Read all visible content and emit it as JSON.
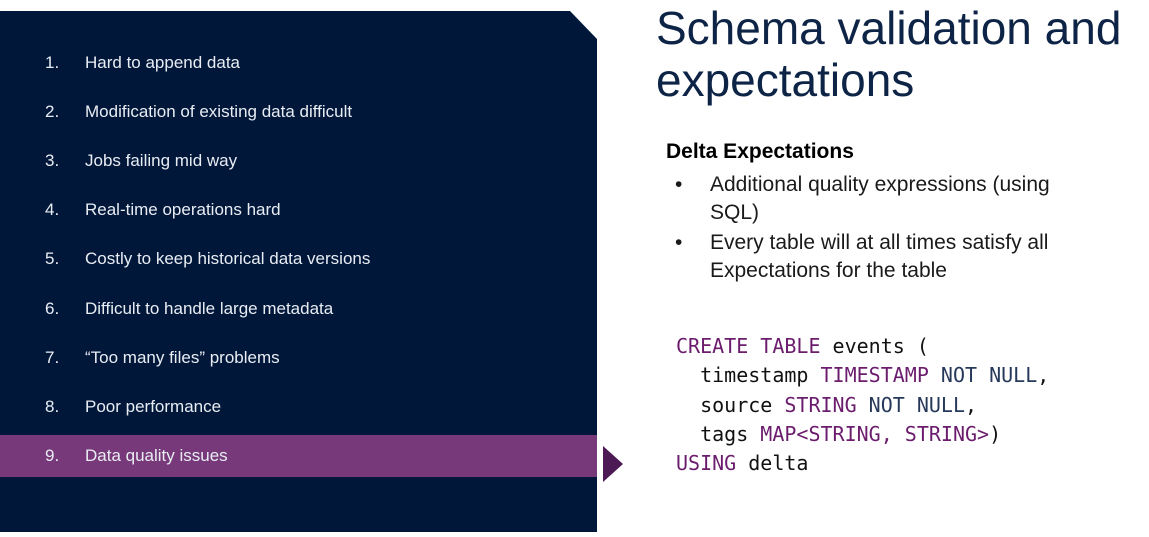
{
  "sidebar": {
    "items": [
      {
        "num": "1.",
        "label": "Hard to append data"
      },
      {
        "num": "2.",
        "label": "Modification of existing data difficult"
      },
      {
        "num": "3.",
        "label": "Jobs failing mid way"
      },
      {
        "num": "4.",
        "label": "Real-time operations hard"
      },
      {
        "num": "5.",
        "label": "Costly to keep historical data versions"
      },
      {
        "num": "6.",
        "label": "Difficult to handle large metadata"
      },
      {
        "num": "7.",
        "label": "“Too many files” problems"
      },
      {
        "num": "8.",
        "label": "Poor performance"
      },
      {
        "num": "9.",
        "label": "Data quality issues"
      }
    ],
    "active_index": 8
  },
  "main": {
    "title_line1": "Schema validation and",
    "title_line2": "expectations",
    "subheading": "Delta Expectations",
    "bullets": [
      "Additional quality expressions (using SQL)",
      "Every table will at all times satisfy all Expectations for the table"
    ],
    "bullet_glyph": "•",
    "code": {
      "line1": {
        "kw1": "CREATE TABLE",
        "ident": " events ("
      },
      "line2": {
        "ident": "  timestamp ",
        "type": "TIMESTAMP",
        "mod": " NOT NULL",
        "tail": ","
      },
      "line3": {
        "ident": "  source ",
        "type": "STRING",
        "mod": " NOT NULL",
        "tail": ","
      },
      "line4": {
        "ident": "  tags ",
        "type": "MAP<STRING, STRING>",
        "tail": ")"
      },
      "line5": {
        "kw1": "USING",
        "ident": " delta"
      }
    }
  },
  "colors": {
    "panel_bg": "#00173a",
    "active_bg": "#773979",
    "arrow": "#4e1a55",
    "title": "#0d2446",
    "keyword": "#6b1c6d"
  }
}
